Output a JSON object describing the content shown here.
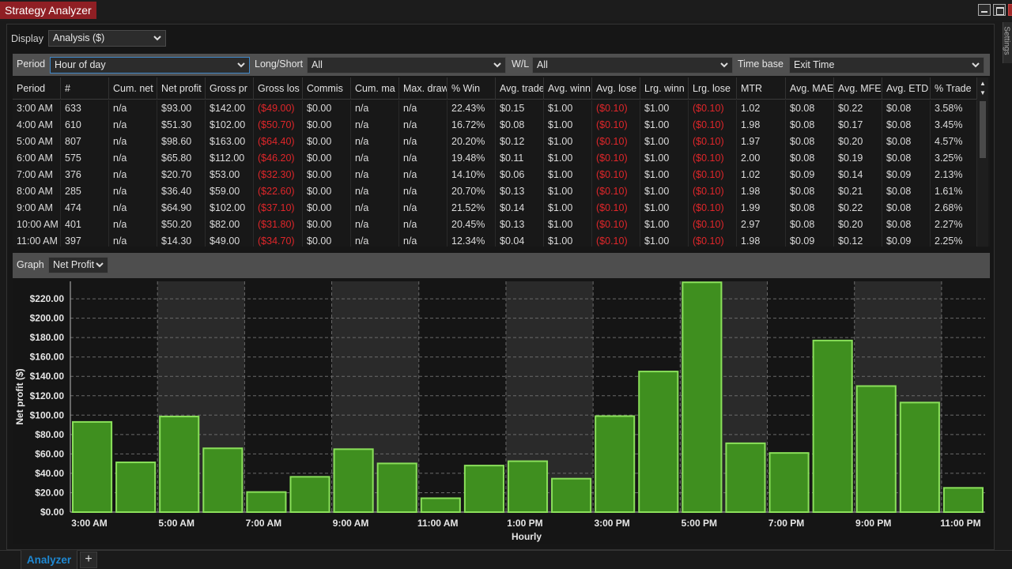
{
  "window": {
    "title": "Strategy Analyzer",
    "side_tab": "Settings"
  },
  "display": {
    "label": "Display",
    "value": "Analysis ($)"
  },
  "filters": {
    "period_label": "Period",
    "period_value": "Hour of day",
    "longshort_label": "Long/Short",
    "longshort_value": "All",
    "wl_label": "W/L",
    "wl_value": "All",
    "timebase_label": "Time base",
    "timebase_value": "Exit Time"
  },
  "grid": {
    "columns": [
      "Period",
      "#",
      "Cum. net",
      "Net profit",
      "Gross pr",
      "Gross los",
      "Commis",
      "Cum. ma",
      "Max. draw",
      "% Win",
      "Avg. trade",
      "Avg. winn",
      "Avg. lose",
      "Lrg. winn",
      "Lrg. lose",
      "MTR",
      "Avg. MAE",
      "Avg. MFE",
      "Avg. ETD",
      "% Trade"
    ],
    "rows": [
      [
        "3:00 AM",
        "633",
        "n/a",
        "$93.00",
        "$142.00",
        "($49.00)",
        "$0.00",
        "n/a",
        "n/a",
        "22.43%",
        "$0.15",
        "$1.00",
        "($0.10)",
        "$1.00",
        "($0.10)",
        "1.02",
        "$0.08",
        "$0.22",
        "$0.08",
        "3.58%"
      ],
      [
        "4:00 AM",
        "610",
        "n/a",
        "$51.30",
        "$102.00",
        "($50.70)",
        "$0.00",
        "n/a",
        "n/a",
        "16.72%",
        "$0.08",
        "$1.00",
        "($0.10)",
        "$1.00",
        "($0.10)",
        "1.98",
        "$0.08",
        "$0.17",
        "$0.08",
        "3.45%"
      ],
      [
        "5:00 AM",
        "807",
        "n/a",
        "$98.60",
        "$163.00",
        "($64.40)",
        "$0.00",
        "n/a",
        "n/a",
        "20.20%",
        "$0.12",
        "$1.00",
        "($0.10)",
        "$1.00",
        "($0.10)",
        "1.97",
        "$0.08",
        "$0.20",
        "$0.08",
        "4.57%"
      ],
      [
        "6:00 AM",
        "575",
        "n/a",
        "$65.80",
        "$112.00",
        "($46.20)",
        "$0.00",
        "n/a",
        "n/a",
        "19.48%",
        "$0.11",
        "$1.00",
        "($0.10)",
        "$1.00",
        "($0.10)",
        "2.00",
        "$0.08",
        "$0.19",
        "$0.08",
        "3.25%"
      ],
      [
        "7:00 AM",
        "376",
        "n/a",
        "$20.70",
        "$53.00",
        "($32.30)",
        "$0.00",
        "n/a",
        "n/a",
        "14.10%",
        "$0.06",
        "$1.00",
        "($0.10)",
        "$1.00",
        "($0.10)",
        "1.02",
        "$0.09",
        "$0.14",
        "$0.09",
        "2.13%"
      ],
      [
        "8:00 AM",
        "285",
        "n/a",
        "$36.40",
        "$59.00",
        "($22.60)",
        "$0.00",
        "n/a",
        "n/a",
        "20.70%",
        "$0.13",
        "$1.00",
        "($0.10)",
        "$1.00",
        "($0.10)",
        "1.98",
        "$0.08",
        "$0.21",
        "$0.08",
        "1.61%"
      ],
      [
        "9:00 AM",
        "474",
        "n/a",
        "$64.90",
        "$102.00",
        "($37.10)",
        "$0.00",
        "n/a",
        "n/a",
        "21.52%",
        "$0.14",
        "$1.00",
        "($0.10)",
        "$1.00",
        "($0.10)",
        "1.99",
        "$0.08",
        "$0.22",
        "$0.08",
        "2.68%"
      ],
      [
        "10:00 AM",
        "401",
        "n/a",
        "$50.20",
        "$82.00",
        "($31.80)",
        "$0.00",
        "n/a",
        "n/a",
        "20.45%",
        "$0.13",
        "$1.00",
        "($0.10)",
        "$1.00",
        "($0.10)",
        "2.97",
        "$0.08",
        "$0.20",
        "$0.08",
        "2.27%"
      ],
      [
        "11:00 AM",
        "397",
        "n/a",
        "$14.30",
        "$49.00",
        "($34.70)",
        "$0.00",
        "n/a",
        "n/a",
        "12.34%",
        "$0.04",
        "$1.00",
        "($0.10)",
        "$1.00",
        "($0.10)",
        "1.98",
        "$0.09",
        "$0.12",
        "$0.09",
        "2.25%"
      ]
    ]
  },
  "graph": {
    "label": "Graph",
    "value": "Net Profit"
  },
  "colors": {
    "bar_fill": "#3f8f1f",
    "bar_stroke": "#8ae05a",
    "negative": "#e0262a",
    "title_tab": "#8f1f24",
    "active_tab": "#1e88d2"
  },
  "chart_data": {
    "type": "bar",
    "categories": [
      "3:00 AM",
      "4:00 AM",
      "5:00 AM",
      "6:00 AM",
      "7:00 AM",
      "8:00 AM",
      "9:00 AM",
      "10:00 AM",
      "11:00 AM",
      "12:00 PM",
      "1:00 PM",
      "2:00 PM",
      "3:00 PM",
      "4:00 PM",
      "5:00 PM",
      "6:00 PM",
      "7:00 PM",
      "8:00 PM",
      "9:00 PM",
      "10:00 PM",
      "11:00 PM"
    ],
    "values": [
      93.0,
      51.3,
      98.6,
      65.8,
      20.7,
      36.4,
      64.9,
      50.2,
      14.3,
      48,
      52.5,
      34.5,
      99,
      145,
      237,
      71,
      61,
      177,
      130,
      113,
      25
    ],
    "tick_labels": [
      "3:00 AM",
      "5:00 AM",
      "7:00 AM",
      "9:00 AM",
      "11:00 AM",
      "1:00 PM",
      "3:00 PM",
      "5:00 PM",
      "7:00 PM",
      "9:00 PM",
      "11:00 PM"
    ],
    "y_ticks": [
      "$0.00",
      "$20.00",
      "$40.00",
      "$60.00",
      "$80.00",
      "$100.00",
      "$120.00",
      "$140.00",
      "$160.00",
      "$180.00",
      "$200.00",
      "$220.00"
    ],
    "xlabel": "Hourly",
    "ylabel": "Net profit ($)",
    "ylim": [
      0,
      238
    ],
    "grid": true
  },
  "bottom": {
    "tab_label": "Analyzer",
    "add_label": "+"
  }
}
